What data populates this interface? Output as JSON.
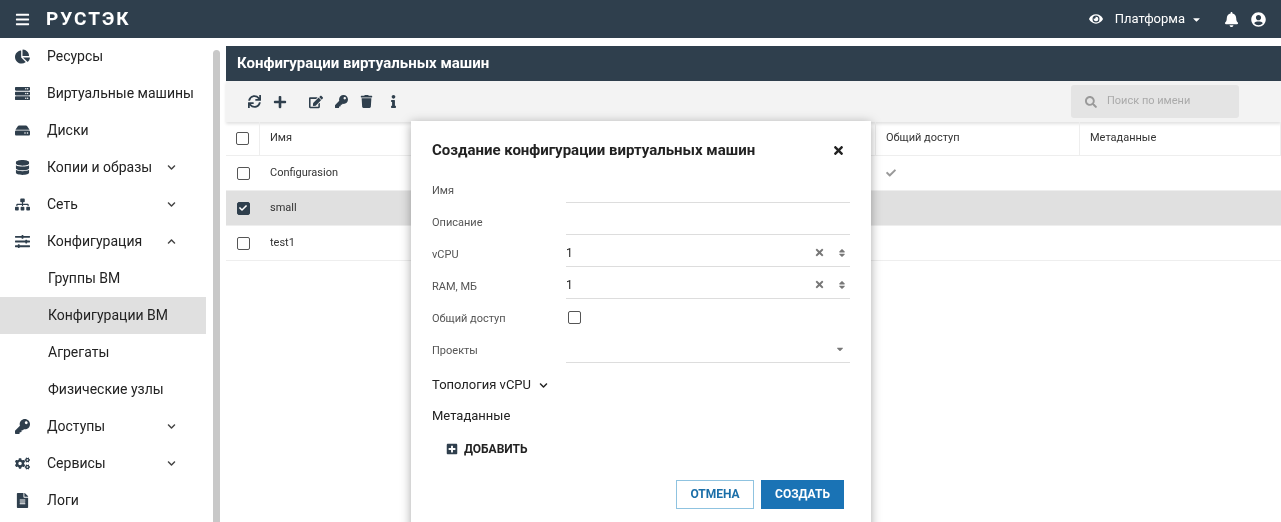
{
  "topbar": {
    "logo": "РУСТЭК",
    "platform": "Платформа"
  },
  "sidebar": {
    "items": [
      {
        "label": "Ресурсы",
        "kind": "link",
        "selected": false
      },
      {
        "label": "Виртуальные машины",
        "kind": "link",
        "selected": false
      },
      {
        "label": "Диски",
        "kind": "link",
        "selected": false
      },
      {
        "label": "Копии и образы",
        "kind": "group",
        "expanded": false,
        "selected": false
      },
      {
        "label": "Сеть",
        "kind": "group",
        "expanded": false,
        "selected": false
      },
      {
        "label": "Конфигурация",
        "kind": "group",
        "expanded": true,
        "selected": false,
        "children": [
          {
            "label": "Группы ВМ",
            "selected": false
          },
          {
            "label": "Конфигурации ВМ",
            "selected": true
          },
          {
            "label": "Агрегаты",
            "selected": false
          },
          {
            "label": "Физические узлы",
            "selected": false
          }
        ]
      },
      {
        "label": "Доступы",
        "kind": "group",
        "expanded": false,
        "selected": false
      },
      {
        "label": "Сервисы",
        "kind": "group",
        "expanded": false,
        "selected": false
      },
      {
        "label": "Логи",
        "kind": "link",
        "selected": false
      }
    ]
  },
  "panel": {
    "title": "Конфигурации виртуальных машин",
    "search": {
      "placeholder": "Поиск по имени"
    }
  },
  "table": {
    "all_checked": false,
    "columns": [
      {
        "label": "Имя"
      },
      {
        "label": "Общий доступ"
      },
      {
        "label": "Метаданные"
      }
    ],
    "rows": [
      {
        "name": "Configurasion",
        "checked": false,
        "selected": false,
        "shared": true
      },
      {
        "name": "small",
        "checked": true,
        "selected": true,
        "shared": false
      },
      {
        "name": "test1",
        "checked": false,
        "selected": false,
        "shared": false
      }
    ]
  },
  "dialog": {
    "title": "Создание конфигурации виртуальных машин",
    "fields": [
      {
        "kind": "text",
        "label": "Имя"
      },
      {
        "kind": "text",
        "label": "Описание"
      },
      {
        "kind": "number",
        "label": "vCPU",
        "value": "1"
      },
      {
        "kind": "number",
        "label": "RAM, МБ",
        "value": "1"
      },
      {
        "kind": "checkbox",
        "label": "Общий доступ",
        "checked": false
      },
      {
        "kind": "select",
        "label": "Проекты"
      }
    ],
    "topology": {
      "label": "Топология vCPU",
      "expanded": false
    },
    "metadata_title": "Метаданные",
    "add_button": "ДОБАВИТЬ",
    "cancel_button": "ОТМЕНА",
    "create_button": "СОЗДАТЬ"
  }
}
